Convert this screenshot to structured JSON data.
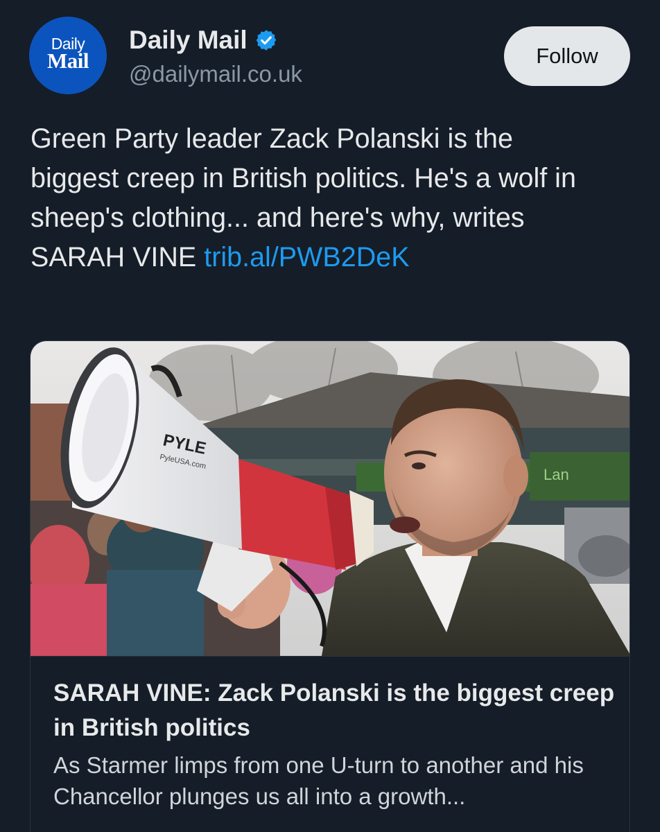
{
  "account": {
    "avatar_line1": "Daily",
    "avatar_line2": "Mail",
    "display_name": "Daily Mail",
    "handle": "@dailymail.co.uk",
    "verified": true
  },
  "actions": {
    "follow_label": "Follow"
  },
  "tweet": {
    "text": "Green Party leader Zack Polanski is the biggest creep in British politics. He's a wolf in sheep's clothing... and here's why, writes SARAH VINE ",
    "link": "trib.al/PWB2DeK"
  },
  "card": {
    "megaphone_brand": "PYLE",
    "megaphone_url": "PyleUSA.com",
    "title": "SARAH VINE: Zack Polanski is the biggest creep in British politics",
    "description": "As Starmer limps from one U-turn to another and his Chancellor plunges us all into a growth..."
  },
  "colors": {
    "background": "#151d28",
    "link": "#1d9bf0",
    "verified_badge": "#1d9bf0",
    "avatar": "#0c54bd",
    "follow_button": "#e4e7ea",
    "handle": "#8b98a5"
  },
  "icons": {
    "verified": "verified-badge-icon"
  }
}
